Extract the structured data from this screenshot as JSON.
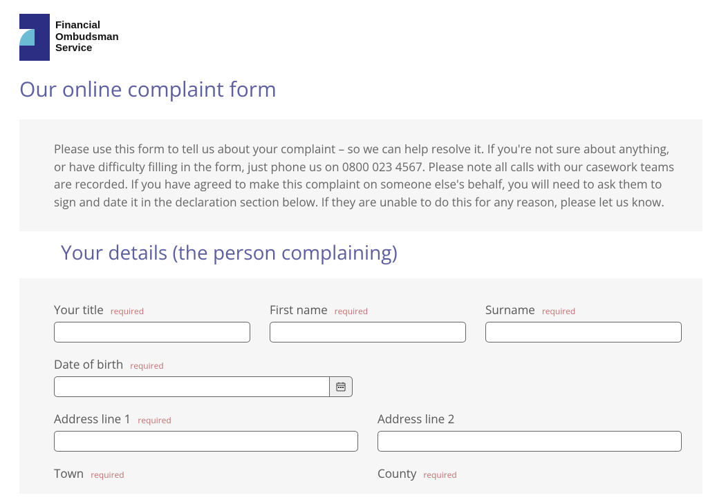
{
  "brand": {
    "line1": "Financial",
    "line2": "Ombudsman",
    "line3": "Service",
    "colors": {
      "navy": "#2b2e83",
      "cyan": "#6bbbd4"
    }
  },
  "page": {
    "title": "Our online complaint form"
  },
  "intro": {
    "text": "Please use this form to tell us about your complaint – so we can help resolve it. If you're not sure about anything, or have difficulty filling in the form, just phone us on 0800 023 4567. Please note all calls with our casework teams are recorded. If you have agreed to make this complaint on someone else's behalf, you will need to ask them to sign and date it in the declaration section below. If they are unable to do this for any reason, please let us know."
  },
  "section": {
    "your_details_heading": "Your details (the person complaining)"
  },
  "labels": {
    "required": "required",
    "your_title": "Your title",
    "first_name": "First name",
    "surname": "Surname",
    "date_of_birth": "Date of birth",
    "address_line_1": "Address line 1",
    "address_line_2": "Address line 2",
    "town": "Town",
    "county": "County"
  },
  "values": {
    "your_title": "",
    "first_name": "",
    "surname": "",
    "date_of_birth": "",
    "address_line_1": "",
    "address_line_2": "",
    "town": "",
    "county": ""
  }
}
